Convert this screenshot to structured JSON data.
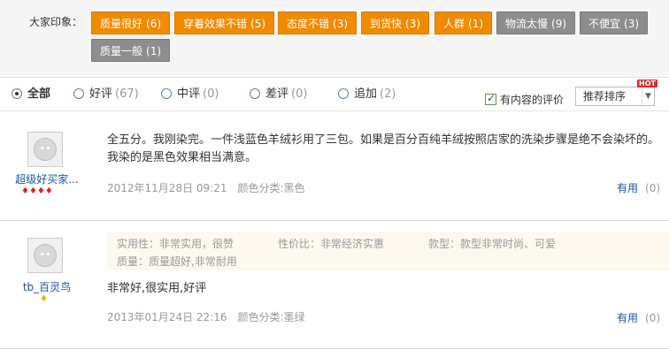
{
  "impressions": {
    "title": "大家印象：",
    "tags": [
      {
        "label": "质量很好",
        "count": "(6)",
        "style": "orange"
      },
      {
        "label": "穿着效果不错",
        "count": "(5)",
        "style": "orange"
      },
      {
        "label": "态度不错",
        "count": "(3)",
        "style": "orange"
      },
      {
        "label": "到货快",
        "count": "(3)",
        "style": "orange"
      },
      {
        "label": "人群",
        "count": "(1)",
        "style": "orange"
      },
      {
        "label": "物流太慢",
        "count": "(9)",
        "style": "gray"
      },
      {
        "label": "不便宜",
        "count": "(3)",
        "style": "gray"
      },
      {
        "label": "质量一般",
        "count": "(1)",
        "style": "gray"
      }
    ]
  },
  "filters": {
    "all": {
      "label": "全部"
    },
    "good": {
      "label": "好评",
      "count": "(67)"
    },
    "mid": {
      "label": "中评",
      "count": "(0)"
    },
    "bad": {
      "label": "差评",
      "count": "(0)"
    },
    "append": {
      "label": "追加",
      "count": "(2)"
    },
    "has_content_label": "有内容的评价",
    "sort_label": "推荐排序",
    "hot_badge": "HOT"
  },
  "reviews": [
    {
      "username": "超级好买家...",
      "level_icons": "♦♦♦♦",
      "content": "全五分。我刚染完。一件浅蓝色羊绒衫用了三包。如果是百分百纯羊绒按照店家的洗染步骤是绝不会染坏的。我染的是黑色效果相当满意。",
      "date": "2012年11月28日 09:21",
      "sku": "颜色分类:黑色",
      "useful_label": "有用",
      "useful_count": "(0)"
    },
    {
      "username": "tb_百灵鸟",
      "level_icons": "♦",
      "attributes": {
        "practical": "实用性：非常实用，很赞",
        "value": "性价比：非常经济实惠",
        "style": "款型：款型非常时尚、可爱",
        "quality": "质量：质量超好,非常耐用"
      },
      "content": "非常好,很实用,好评",
      "date": "2013年01月24日 22:16",
      "sku": "颜色分类:墨绿",
      "useful_label": "有用",
      "useful_count": "(0)"
    }
  ],
  "colors": {
    "tag_orange": "#f08a00",
    "tag_gray": "#8d8d8d",
    "link_blue": "#1a55a6"
  }
}
